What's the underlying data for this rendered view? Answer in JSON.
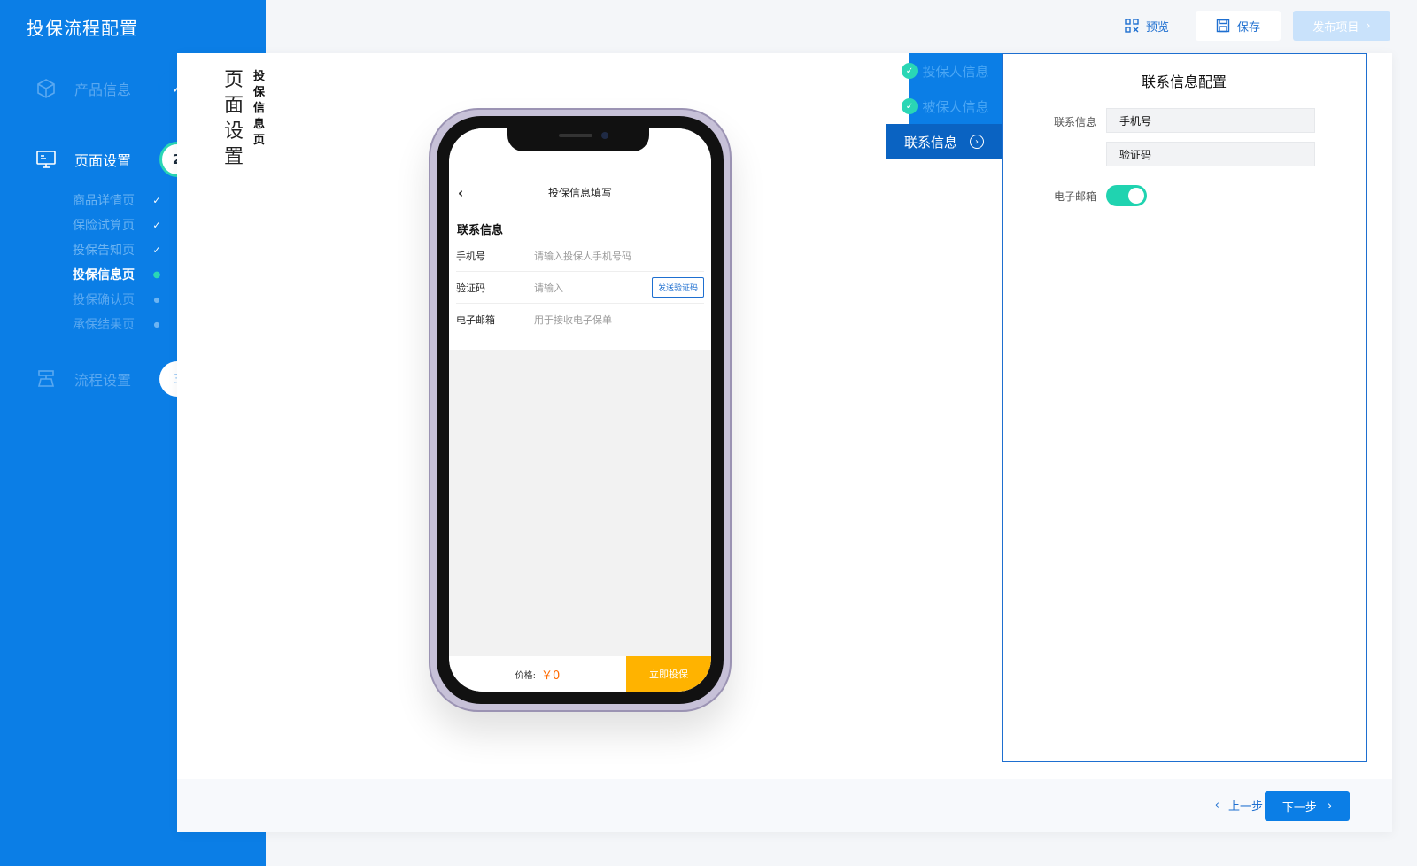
{
  "app": {
    "title": "投保流程配置"
  },
  "topbar": {
    "preview": "预览",
    "save": "保存",
    "publish": "发布项目"
  },
  "steps": [
    {
      "label": "产品信息",
      "badge": "✓"
    },
    {
      "label": "页面设置",
      "badge": "2"
    },
    {
      "label": "流程设置",
      "badge": "3"
    }
  ],
  "substeps": [
    {
      "label": "商品详情页",
      "mark": "✓"
    },
    {
      "label": "保险试算页",
      "mark": "✓"
    },
    {
      "label": "投保告知页",
      "mark": "✓"
    },
    {
      "label": "投保信息页",
      "mark": "●"
    },
    {
      "label": "投保确认页",
      "mark": "●"
    },
    {
      "label": "承保结果页",
      "mark": "●"
    }
  ],
  "page": {
    "title": "页面设置",
    "subtitle": "投保信息页"
  },
  "phone": {
    "back": "‹",
    "title": "投保信息填写",
    "section": "联系信息",
    "rows": [
      {
        "label": "手机号",
        "placeholder": "请输入投保人手机号码"
      },
      {
        "label": "验证码",
        "placeholder": "请输入",
        "button": "发送验证码"
      },
      {
        "label": "电子邮箱",
        "placeholder": "用于接收电子保单"
      }
    ],
    "price_label": "价格:",
    "price_value": "￥0",
    "buy": "立即投保"
  },
  "tabs": [
    {
      "label": "投保人信息",
      "done": true
    },
    {
      "label": "被保人信息",
      "done": true
    },
    {
      "label": "联系信息",
      "active": true
    }
  ],
  "config": {
    "title": "联系信息配置",
    "contact_label": "联系信息",
    "contact_fields": [
      "手机号",
      "验证码"
    ],
    "email_label": "电子邮箱",
    "email_enabled": true
  },
  "footer": {
    "prev": "上一步",
    "next": "下一步"
  },
  "colors": {
    "brand": "#0b7ee6",
    "accent": "#2ad6b5",
    "buy": "#ffb300",
    "price": "#ff6a00"
  }
}
